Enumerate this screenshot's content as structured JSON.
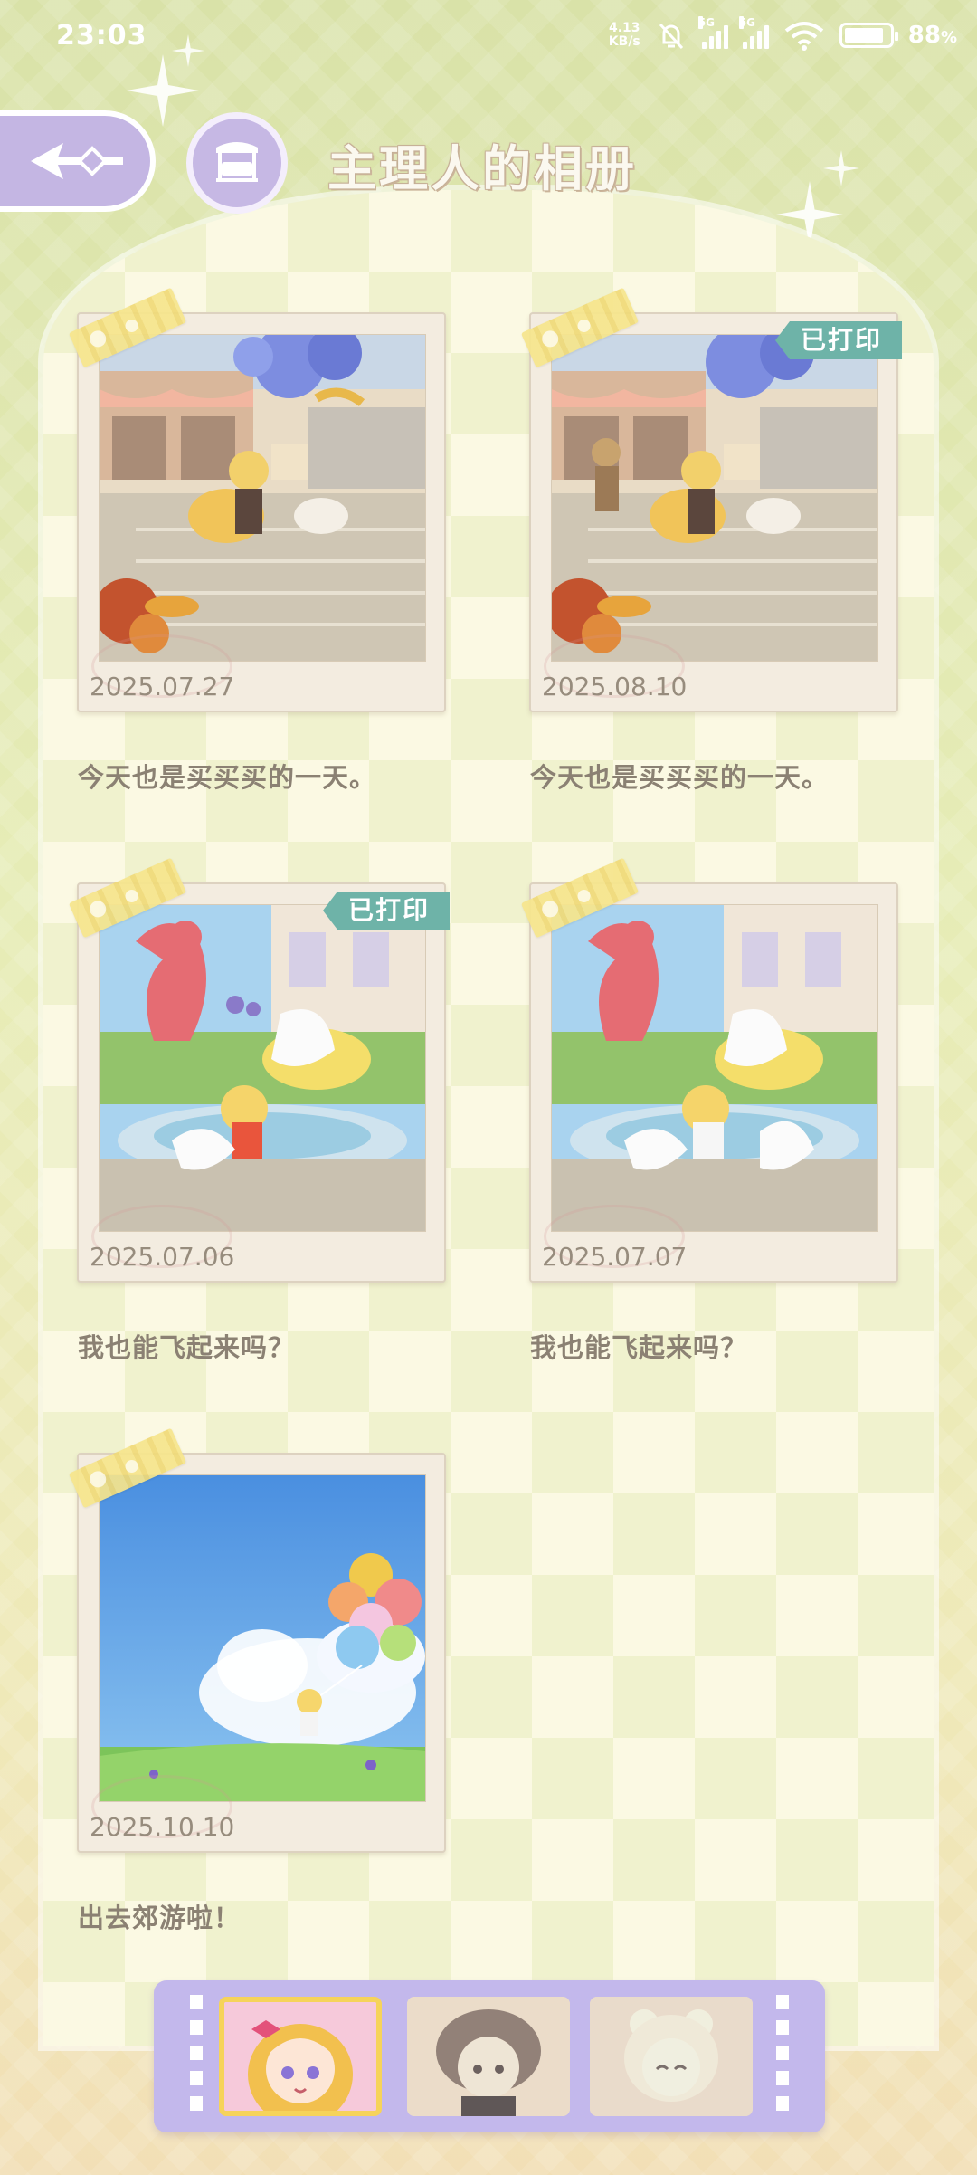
{
  "status_bar": {
    "time": "23:03",
    "net_speed_value": "4.13",
    "net_speed_unit": "KB/s",
    "signal1_gen": "5G",
    "signal2_gen": "5G",
    "battery_percent": "88",
    "battery_unit": "%",
    "icons": [
      "mute-bell-icon",
      "signal-icon",
      "signal-icon",
      "wifi-icon",
      "battery-icon"
    ]
  },
  "header": {
    "title": "主理人的相册",
    "back_icon": "back-arrow-icon",
    "home_icon": "bed-icon"
  },
  "colors": {
    "accent_purple": "#c4b6e3",
    "printed_badge": "#6eb3a8",
    "selected_border": "#f6d35a",
    "caption_text": "#8b8173"
  },
  "photos": [
    {
      "date": "2025.07.27",
      "caption": "今天也是买买买的一天。",
      "printed_label": ""
    },
    {
      "date": "2025.08.10",
      "caption": "今天也是买买买的一天。",
      "printed_label": "已打印"
    },
    {
      "date": "2025.07.06",
      "caption": "我也能飞起来吗？",
      "printed_label": "已打印"
    },
    {
      "date": "2025.07.07",
      "caption": "我也能飞起来吗？",
      "printed_label": ""
    },
    {
      "date": "2025.10.10",
      "caption": "出去郊游啦！",
      "printed_label": ""
    }
  ],
  "characters": [
    {
      "name": "character-blonde-girl",
      "selected": true
    },
    {
      "name": "character-curly-brown",
      "selected": false
    },
    {
      "name": "character-bear-ears",
      "selected": false
    }
  ]
}
